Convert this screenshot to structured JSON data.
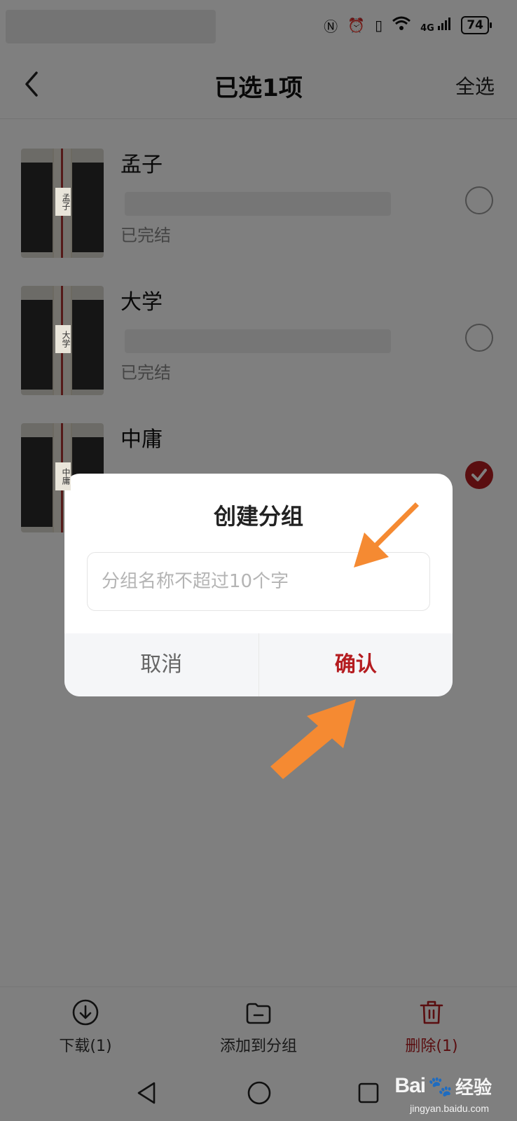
{
  "status_bar": {
    "network": "4G",
    "battery": "74"
  },
  "header": {
    "title": "已选1项",
    "select_all_label": "全选"
  },
  "books": [
    {
      "name": "孟子",
      "status": "已完结",
      "cover_text": "孟子",
      "selected": false
    },
    {
      "name": "大学",
      "status": "已完结",
      "cover_text": "大学",
      "selected": false
    },
    {
      "name": "中庸",
      "status": "",
      "cover_text": "中庸",
      "selected": true
    }
  ],
  "dialog": {
    "title": "创建分组",
    "input_value": "",
    "input_placeholder": "分组名称不超过10个字",
    "cancel_label": "取消",
    "confirm_label": "确认"
  },
  "toolbar": {
    "download_label": "下载(1)",
    "add_to_group_label": "添加到分组",
    "delete_label": "删除(1)"
  },
  "watermark": {
    "brand": "Bai",
    "suffix": "经验",
    "url": "jingyan.baidu.com"
  },
  "colors": {
    "accent": "#b51c20",
    "overlay": "rgba(0,0,0,0.5)",
    "annotation_arrow": "#f58a32"
  }
}
